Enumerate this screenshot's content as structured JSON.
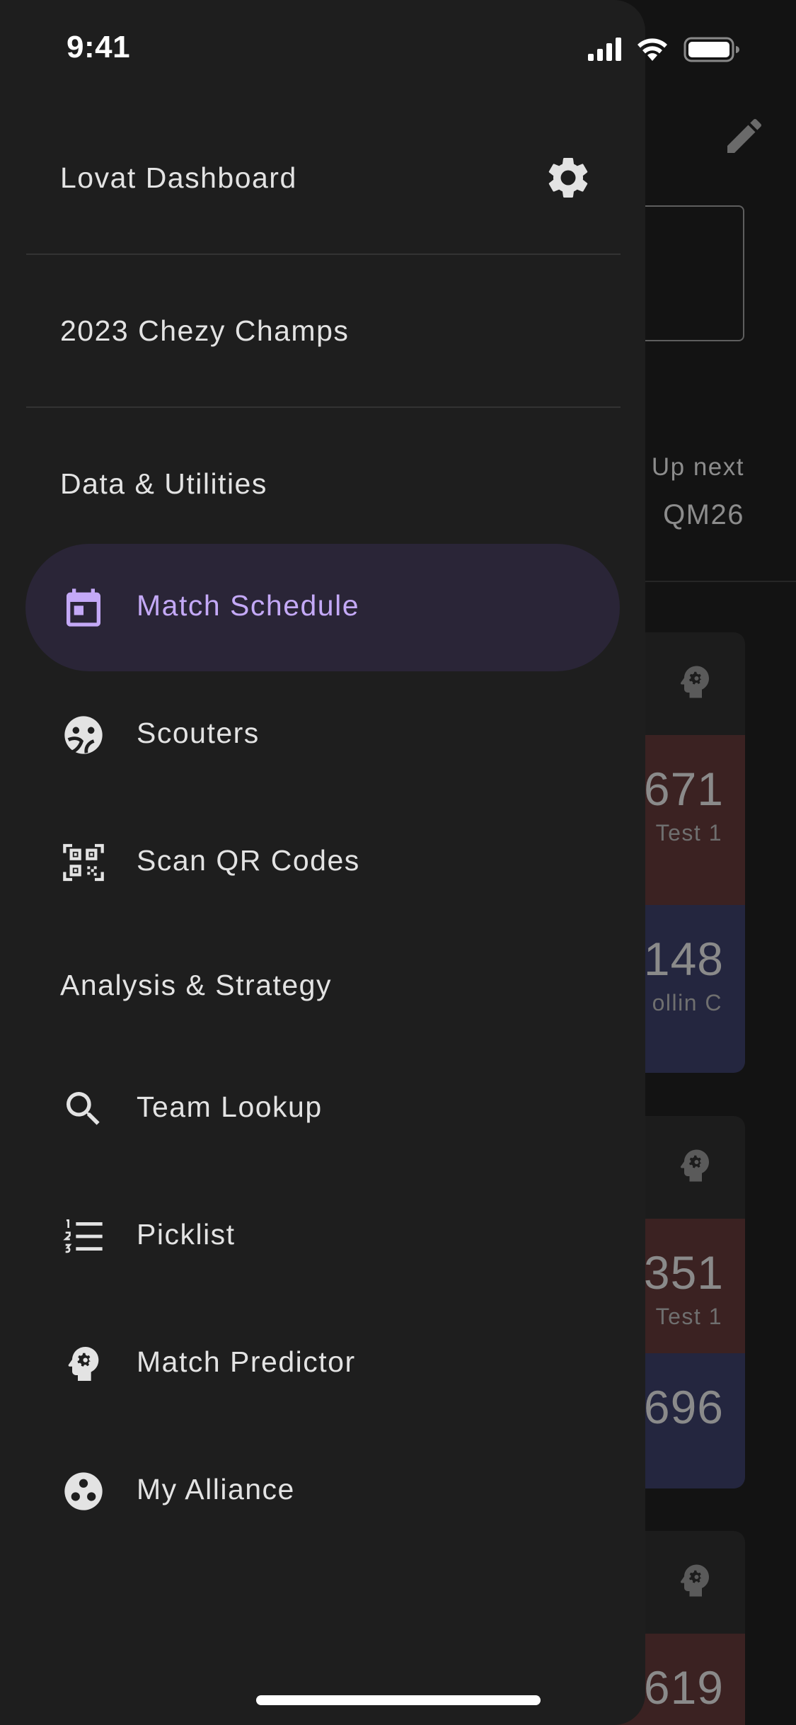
{
  "status_bar": {
    "time": "9:41"
  },
  "drawer": {
    "app_title": "Lovat Dashboard",
    "tournament": "2023 Chezy Champs",
    "sections": [
      {
        "label": "Data & Utilities",
        "items": [
          {
            "label": "Match Schedule",
            "icon": "calendar-icon",
            "active": true
          },
          {
            "label": "Scouters",
            "icon": "scouters-icon",
            "active": false
          },
          {
            "label": "Scan QR Codes",
            "icon": "qr-scan-icon",
            "active": false
          }
        ]
      },
      {
        "label": "Analysis & Strategy",
        "items": [
          {
            "label": "Team Lookup",
            "icon": "search-icon",
            "active": false
          },
          {
            "label": "Picklist",
            "icon": "numbered-list-icon",
            "active": false
          },
          {
            "label": "Match Predictor",
            "icon": "head-gear-icon",
            "active": false
          },
          {
            "label": "My Alliance",
            "icon": "alliance-icon",
            "active": false
          }
        ]
      }
    ]
  },
  "background": {
    "up_next_label": "Up next",
    "up_next_match": "QM26",
    "cards": [
      {
        "red_team": "671",
        "red_scout": "Test 1",
        "blue_team": "148",
        "blue_scout": "ollin C"
      },
      {
        "red_team": "351",
        "red_scout": "Test 1",
        "blue_team": "696",
        "blue_scout": ""
      },
      {
        "red_team": "619",
        "red_scout": "",
        "blue_team": "",
        "blue_scout": ""
      }
    ]
  },
  "colors": {
    "drawer_bg": "#1e1e1e",
    "active_item_bg": "#2a2537",
    "accent": "#c4a9f7",
    "red_alliance": "#3b2222",
    "blue_alliance": "#24263f"
  }
}
